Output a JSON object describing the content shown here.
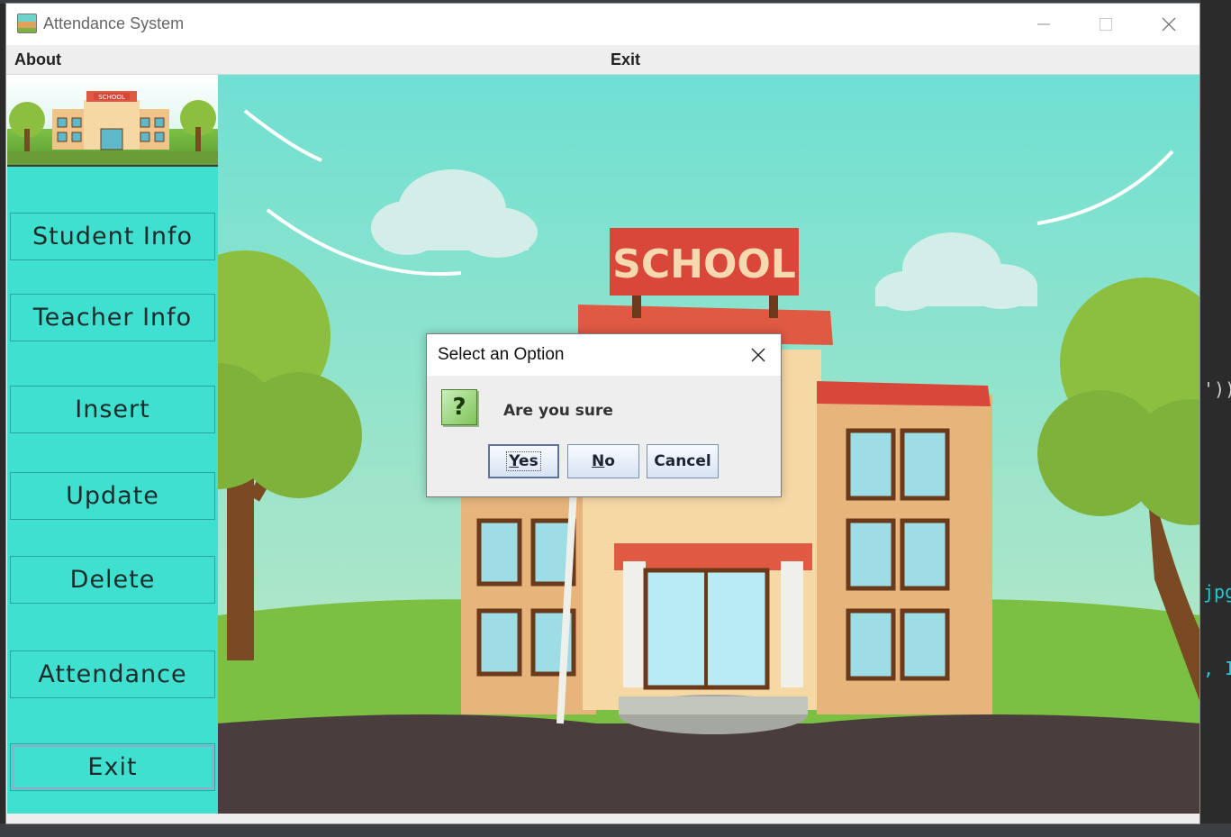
{
  "window": {
    "title": "Attendance System",
    "icon": "app-school-icon"
  },
  "menubar": {
    "about": "About",
    "exit": "Exit"
  },
  "sidebar": {
    "logo_text": "SCHOOL",
    "buttons": [
      {
        "label": "Student Info"
      },
      {
        "label": "Teacher Info"
      },
      {
        "label": "Insert"
      },
      {
        "label": "Update"
      },
      {
        "label": "Delete"
      },
      {
        "label": "Attendance"
      },
      {
        "label": "Exit"
      }
    ]
  },
  "scene": {
    "sign_text": "SCHOOL"
  },
  "dialog": {
    "title": "Select an Option",
    "icon": "question-icon",
    "icon_glyph": "?",
    "message": "Are you sure",
    "yes_first": "Y",
    "yes_rest": "es",
    "no_first": "N",
    "no_rest": "o",
    "cancel": "Cancel"
  },
  "ide_background": {
    "line1": "'))",
    "line2": "jpg",
    "line3": ", I"
  },
  "colors": {
    "sidebar": "#3fe0d0",
    "sky_top": "#6fe0d2",
    "sky_bottom": "#bfe8c6",
    "ground": "#7cc043",
    "road": "#4a3d3d",
    "sign": "#d9473a"
  }
}
